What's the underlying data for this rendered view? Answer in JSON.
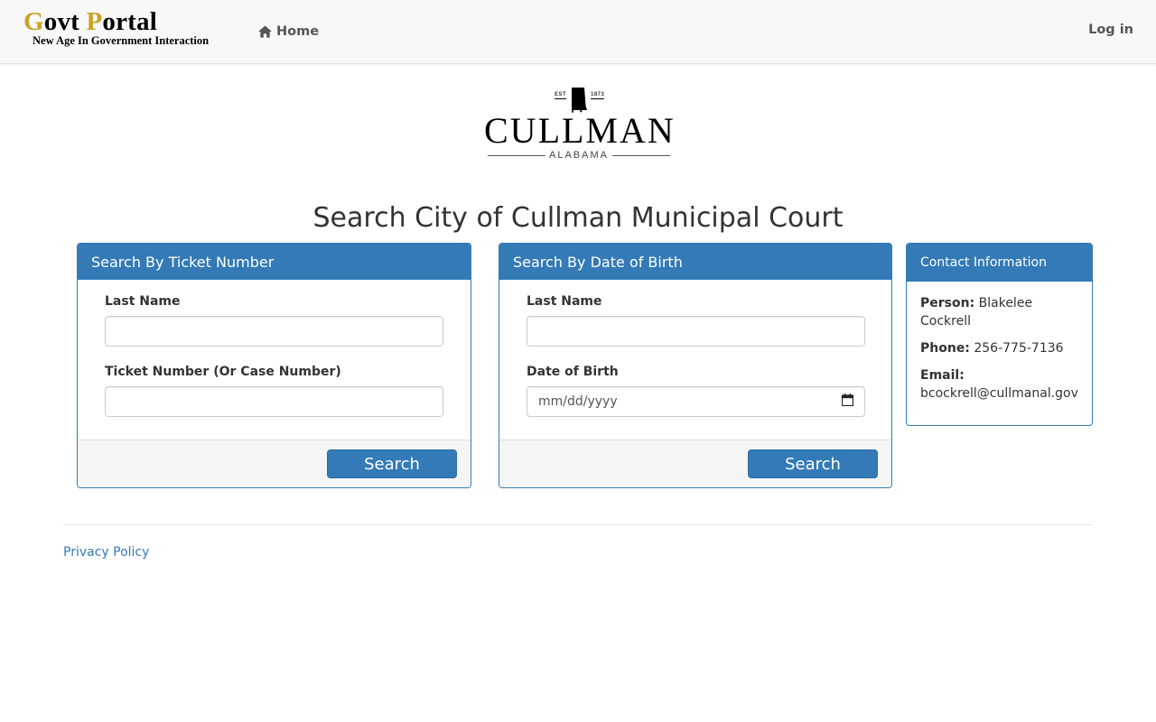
{
  "navbar": {
    "brand_title_first": "G",
    "brand_title_mid": "ovt ",
    "brand_title_p": "P",
    "brand_title_rest": "ortal",
    "brand_tagline": "New Age In Government Interaction",
    "home_label": "Home",
    "home_icon": "home-icon",
    "login_label": "Log in"
  },
  "logo": {
    "est_label": "EST",
    "est_year": "1873",
    "city_name": "CULLMAN",
    "state_name": "ALABAMA"
  },
  "page_title": "Search City of Cullman Municipal Court",
  "ticket_search": {
    "heading": "Search By Ticket Number",
    "last_name_label": "Last Name",
    "last_name_value": "",
    "ticket_label": "Ticket Number (Or Case Number)",
    "ticket_value": "",
    "button_label": "Search"
  },
  "dob_search": {
    "heading": "Search By Date of Birth",
    "last_name_label": "Last Name",
    "last_name_value": "",
    "dob_label": "Date of Birth",
    "dob_placeholder": "mm/dd/yyyy",
    "dob_icon": "calendar-icon",
    "button_label": "Search"
  },
  "contact": {
    "heading": "Contact Information",
    "person_label": "Person:",
    "person_value": "Blakelee Cockrell",
    "phone_label": "Phone:",
    "phone_value": "256-775-7136",
    "email_label": "Email:",
    "email_value": "bcockrell@cullmanal.gov"
  },
  "footer": {
    "privacy_label": "Privacy Policy"
  },
  "colors": {
    "primary": "#337ab7",
    "brand_gold": "#c9a227",
    "navbar_bg": "#f8f8f8",
    "panel_footer_bg": "#f5f5f5"
  }
}
